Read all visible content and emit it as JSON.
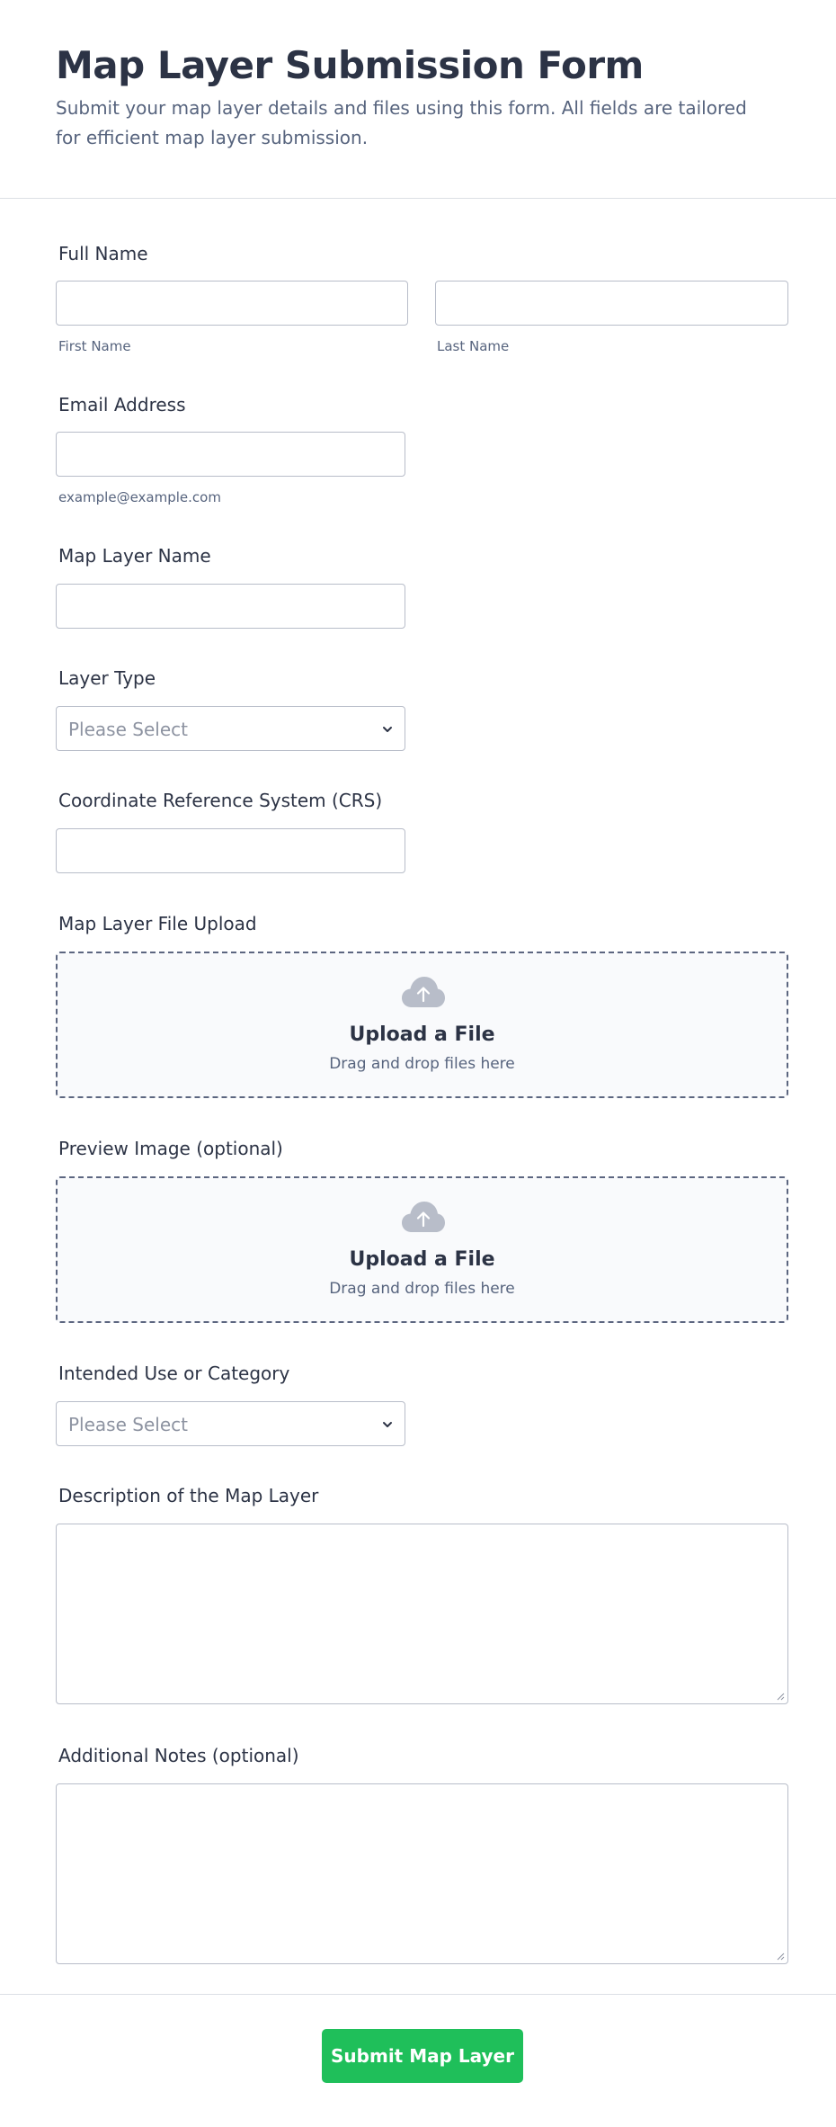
{
  "form": {
    "title": "Map Layer Submission Form",
    "subtitle": "Submit your map layer details and files using this form. All fields are tailored for efficient map layer submission."
  },
  "fields": {
    "full_name": {
      "label": "Full Name",
      "first_sublabel": "First Name",
      "last_sublabel": "Last Name"
    },
    "email": {
      "label": "Email Address",
      "sublabel": "example@example.com"
    },
    "layer_name": {
      "label": "Map Layer Name"
    },
    "layer_type": {
      "label": "Layer Type",
      "placeholder": "Please Select"
    },
    "crs": {
      "label": "Coordinate Reference System (CRS)"
    },
    "file_upload": {
      "label": "Map Layer File Upload",
      "title": "Upload a File",
      "hint": "Drag and drop files here"
    },
    "preview_image": {
      "label": "Preview Image (optional)",
      "title": "Upload a File",
      "hint": "Drag and drop files here"
    },
    "intended_use": {
      "label": "Intended Use or Category",
      "placeholder": "Please Select"
    },
    "description": {
      "label": "Description of the Map Layer"
    },
    "notes": {
      "label": "Additional Notes (optional)"
    }
  },
  "footer": {
    "submit_label": "Submit Map Layer"
  },
  "colors": {
    "accent": "#1fbf5a",
    "text": "#2c3345",
    "muted": "#57647e",
    "border": "#b8bdc9"
  },
  "icons": {
    "upload": "cloud-upload-icon",
    "select": "chevron-down-icon",
    "resize": "resize-grip-icon"
  }
}
